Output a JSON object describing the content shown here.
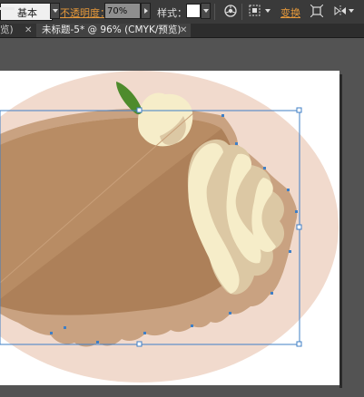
{
  "control_bar": {
    "profile_label": "基本",
    "opacity_label": "不透明度：",
    "opacity_value": "70%",
    "style_label": "样式：",
    "transform_label": "变换",
    "style_color": "#ffffff",
    "opacity_label_color": "#e6993a"
  },
  "tabs": [
    {
      "label": "览)",
      "active": false
    },
    {
      "label": "未标题-5* @ 96% (CMYK/预览)",
      "active": true
    }
  ],
  "icons": {
    "recolor": "recolor-artwork-icon",
    "align": "align-icon",
    "transform_each": "transform-each-icon",
    "flip": "flip-icon"
  },
  "colors": {
    "background_ellipse": "#f1dacd",
    "pie_crust_rim": "#c9a281",
    "pie_filling": "#ad8059",
    "cream": "#dcc8a4",
    "cream_highlight": "#f6edc9",
    "leaf": "#4e8b2c",
    "selection": "#3f7fc6"
  }
}
